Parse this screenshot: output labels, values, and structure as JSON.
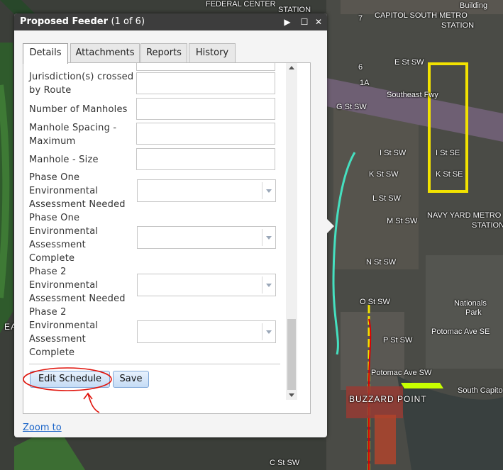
{
  "popup": {
    "title": "Proposed Feeder",
    "count": "(1 of 6)",
    "tabs": [
      "Details",
      "Attachments",
      "Reports",
      "History"
    ],
    "fields": {
      "jurisdiction": "Jurisdiction(s) crossed by Route",
      "manholes": "Number of Manholes",
      "spacing": "Manhole Spacing - Maximum",
      "size": "Manhole - Size",
      "p1_needed": "Phase One Environmental Assessment Needed",
      "p1_complete": "Phase One Environmental Assessment Complete",
      "p2_needed": "Phase 2 Environmental Assessment Needed",
      "p2_complete": "Phase 2 Environmental Assessment Complete"
    },
    "buttons": {
      "edit_schedule": "Edit Schedule",
      "save": "Save"
    },
    "zoom_link": "Zoom to"
  },
  "map": {
    "labels": {
      "federal_center": "FEDERAL CENTER",
      "station_top": "STATION",
      "capitol_south": "CAPITOL SOUTH METRO",
      "station_cs": "STATION",
      "building": "Building",
      "route7": "7",
      "route6": "6",
      "route1a": "1A",
      "e_st": "E St SW",
      "southeast_fwy": "Southeast Fwy",
      "g_st": "G St SW",
      "i_st": "I St SW",
      "k_st": "K St SW",
      "l_st": "L St SW",
      "m_st": "M St SW",
      "n_st": "N St SW",
      "o_st": "O St SW",
      "p_st": "P St SW",
      "i_st_se": "I St SE",
      "k_st_se": "K St SE",
      "navy_yard": "NAVY YARD METRO",
      "station_ny": "STATION",
      "nationals": "Nationals",
      "park": "Park",
      "buzzard": "BUZZARD POINT",
      "south_cap": "South Capito",
      "potomac": "Potomac Ave SW",
      "potomac_se": "Potomac Ave SE",
      "c_st": "C St SW",
      "ea": "EA"
    }
  }
}
